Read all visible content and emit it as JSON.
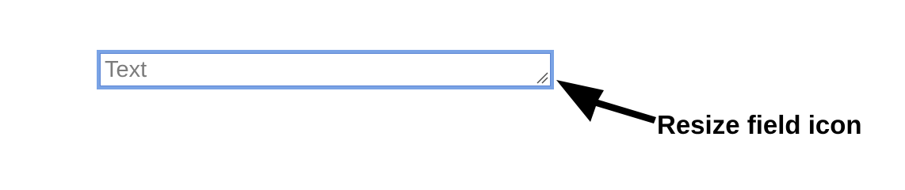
{
  "text_field": {
    "placeholder": "Text",
    "value": ""
  },
  "resize_handle": {
    "icon": "resize-grip-icon"
  },
  "annotation": {
    "label": "Resize field icon",
    "arrow_icon": "arrow-icon"
  },
  "colors": {
    "focus_border": "#7aa3e5",
    "placeholder": "#7c7c7c",
    "annotation": "#000000"
  }
}
